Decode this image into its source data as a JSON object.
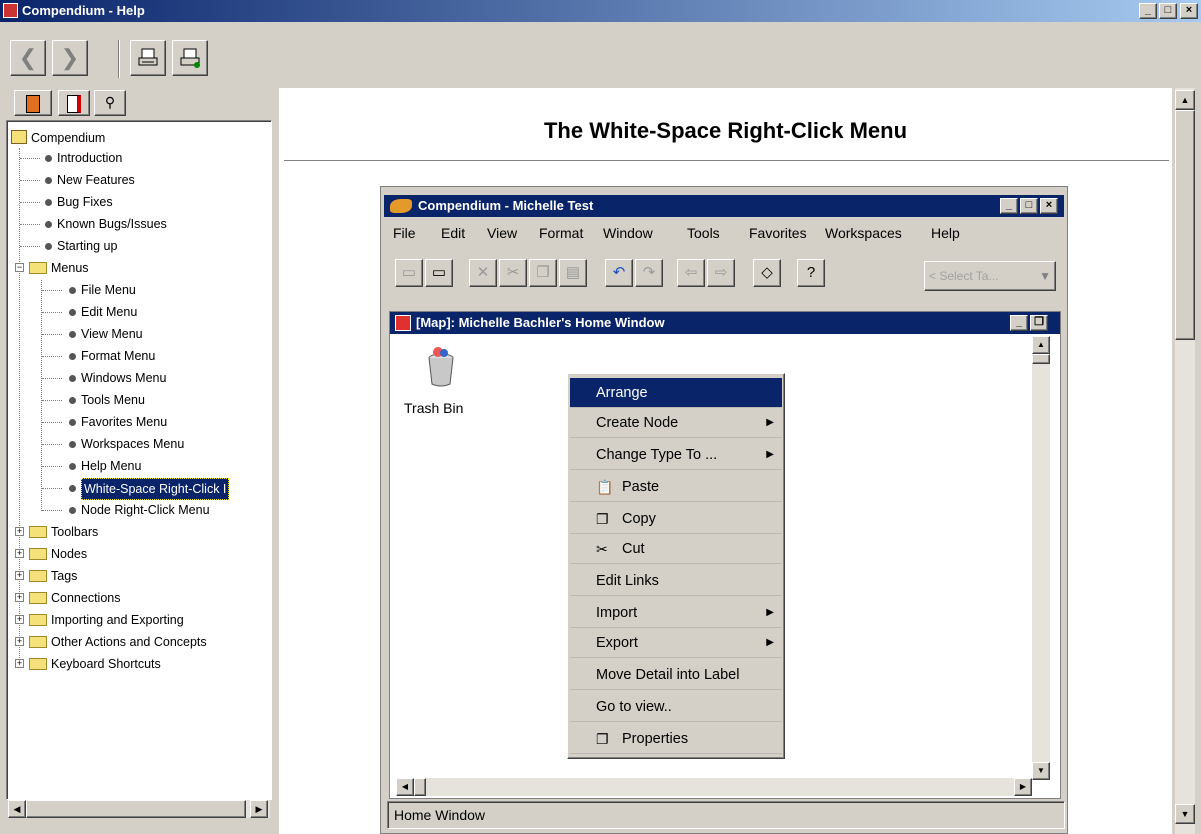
{
  "window": {
    "title": "Compendium - Help",
    "controls": [
      "_",
      "□",
      "X"
    ]
  },
  "toolbar": {
    "back": "<",
    "forward": ">",
    "print": "print",
    "options": "print-setup"
  },
  "nav_tabs": [
    "contents",
    "index",
    "search"
  ],
  "tree": {
    "root": "Compendium",
    "items": [
      {
        "label": "Introduction"
      },
      {
        "label": "New Features"
      },
      {
        "label": "Bug Fixes"
      },
      {
        "label": "Known Bugs/Issues"
      },
      {
        "label": "Starting up"
      }
    ],
    "menus": {
      "label": "Menus",
      "children": [
        "File Menu",
        "Edit Menu",
        "View Menu",
        "Format Menu",
        "Windows Menu",
        "Tools Menu",
        "Favorites Menu",
        "Workspaces Menu",
        "Help Menu",
        "White-Space Right-Click I",
        "Node Right-Click Menu"
      ]
    },
    "folders": [
      "Toolbars",
      "Nodes",
      "Tags",
      "Connections",
      "Importing and Exporting",
      "Other Actions and Concepts",
      "Keyboard Shortcuts"
    ]
  },
  "page": {
    "heading": "The White-Space Right-Click Menu"
  },
  "inner": {
    "title": "Compendium - Michelle Test",
    "menu": [
      "File",
      "Edit",
      "View",
      "Format",
      "Window",
      "Tools",
      "Favorites",
      "Workspaces",
      "Help"
    ],
    "select_tag": "< Select Ta...",
    "map_title": "[Map]:  Michelle Bachler's Home Window",
    "trash": "Trash Bin",
    "status": "Home Window"
  },
  "context_menu": [
    {
      "label": "Arrange",
      "selected": true
    },
    {
      "label": "Create Node",
      "submenu": true
    },
    {
      "label": "Change Type To ...",
      "submenu": true
    },
    {
      "label": "Paste",
      "icon": "paste-icon"
    },
    {
      "label": "Copy",
      "icon": "copy-icon"
    },
    {
      "label": "Cut",
      "icon": "cut-icon"
    },
    {
      "label": "Edit Links"
    },
    {
      "label": "Import",
      "submenu": true
    },
    {
      "label": "Export",
      "submenu": true
    },
    {
      "label": "Move Detail into Label"
    },
    {
      "label": "Go to view.."
    },
    {
      "label": "Properties",
      "icon": "properties-icon"
    }
  ],
  "colors": {
    "titlebar": "#0a246a",
    "selection": "#0a246a",
    "face": "#d4d0c8"
  }
}
